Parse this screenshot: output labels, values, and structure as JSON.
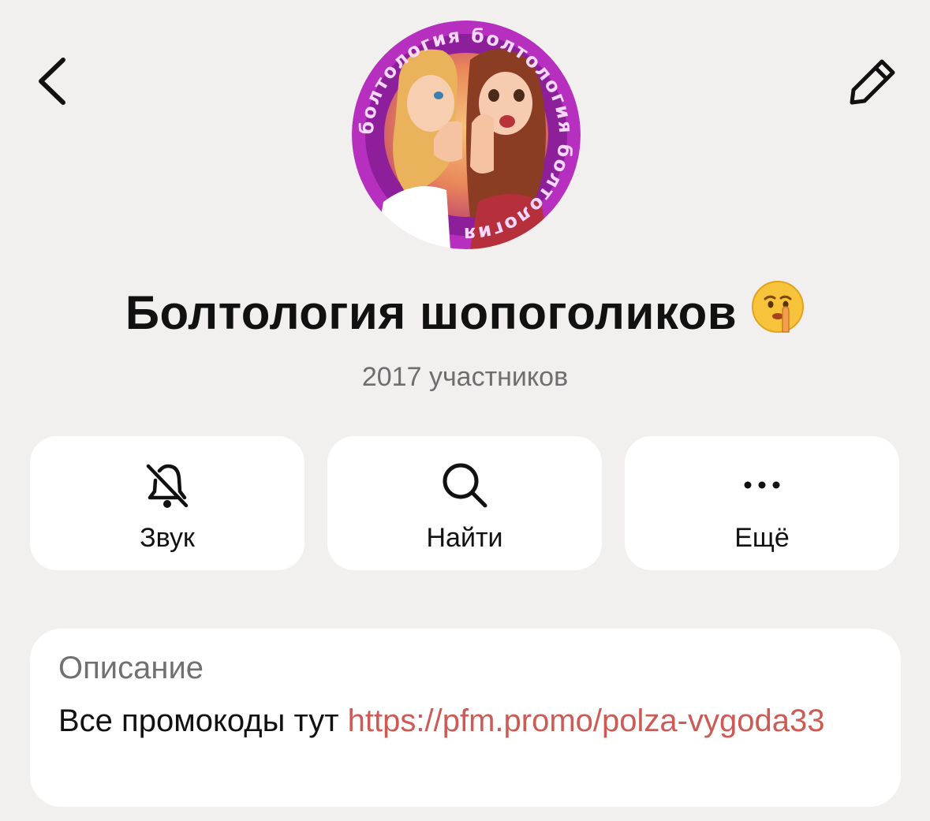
{
  "header": {
    "back_icon": "chevron-left-icon",
    "edit_icon": "pencil-icon"
  },
  "chat": {
    "avatar_text": "болтология болтология болтология",
    "title": "Болтология шопоголиков",
    "title_emoji": "🤫",
    "members": "2017 участников"
  },
  "actions": [
    {
      "label": "Звук",
      "icon": "bell-slash-icon"
    },
    {
      "label": "Найти",
      "icon": "search-icon"
    },
    {
      "label": "Ещё",
      "icon": "more-dots-icon"
    }
  ],
  "description": {
    "heading": "Описание",
    "text": "Все промокоды тут ",
    "link": "https://pfm.promo/polza-vygoda33"
  },
  "colors": {
    "background": "#f1f0ef",
    "card": "#ffffff",
    "link": "#cc5b55",
    "secondary_text": "#6e6e70",
    "avatar_ring": "#b62fbf"
  }
}
